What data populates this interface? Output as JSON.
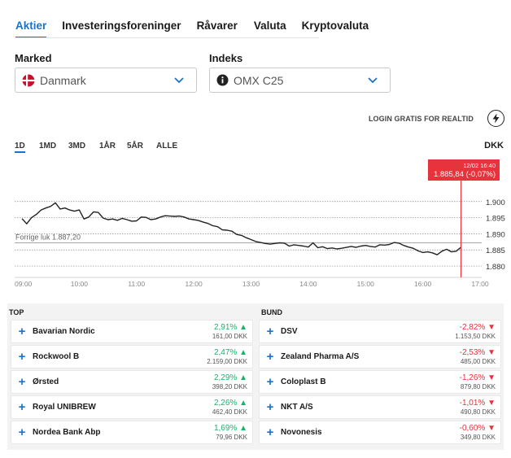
{
  "tabs": [
    {
      "label": "Aktier",
      "active": true
    },
    {
      "label": "Investeringsforeninger",
      "active": false
    },
    {
      "label": "Råvarer",
      "active": false
    },
    {
      "label": "Valuta",
      "active": false
    },
    {
      "label": "Kryptovaluta",
      "active": false
    }
  ],
  "filters": {
    "market_label": "Marked",
    "market_value": "Danmark",
    "index_label": "Indeks",
    "index_value": "OMX C25"
  },
  "login_label": "LOGIN GRATIS FOR REALTID",
  "ranges": [
    {
      "label": "1D",
      "active": true
    },
    {
      "label": "1MD",
      "active": false
    },
    {
      "label": "3MD",
      "active": false
    },
    {
      "label": "1ÅR",
      "active": false
    },
    {
      "label": "5ÅR",
      "active": false
    },
    {
      "label": "ALLE",
      "active": false
    }
  ],
  "currency": "DKK",
  "colors": {
    "accent": "#1a73c9",
    "up": "#1ab36b",
    "down": "#e8323c"
  },
  "chart_data": {
    "type": "line",
    "x_ticks": [
      "09:00",
      "10:00",
      "11:00",
      "12:00",
      "13:00",
      "14:00",
      "15:00",
      "16:00",
      "17:00"
    ],
    "y_ticks": [
      1900,
      1895,
      1890,
      1885,
      1880
    ],
    "y_tick_labels": [
      "1.900",
      "1.895",
      "1.890",
      "1.885",
      "1.880"
    ],
    "ylim": [
      1878.5,
      1907
    ],
    "xlim": [
      "09:00",
      "17:00"
    ],
    "reference_label": "Forrige luk 1.887,20",
    "reference_value": 1887.2,
    "cursor_time": "16:40",
    "tooltip_date": "12/02 16:40",
    "tooltip_value": "1.885,84 (-0,07%)",
    "series": [
      {
        "x": [
          "09:00",
          "09:05",
          "09:10",
          "09:15",
          "09:20",
          "09:25",
          "09:30",
          "09:35",
          "09:40",
          "09:45",
          "09:50",
          "09:55",
          "10:00",
          "10:05",
          "10:10",
          "10:15",
          "10:20",
          "10:25",
          "10:30",
          "10:35",
          "10:40",
          "10:45",
          "10:50",
          "10:55",
          "11:00",
          "11:05",
          "11:10",
          "11:15",
          "11:20",
          "11:25",
          "11:30",
          "11:35",
          "11:40",
          "11:45",
          "11:50",
          "11:55",
          "12:00",
          "12:05",
          "12:10",
          "12:15",
          "12:20",
          "12:25",
          "12:30",
          "12:35",
          "12:40",
          "12:45",
          "12:50",
          "12:55",
          "13:00",
          "13:05",
          "13:10",
          "13:15",
          "13:20",
          "13:25",
          "13:30",
          "13:35",
          "13:40",
          "13:45",
          "13:50",
          "13:55",
          "14:00",
          "14:05",
          "14:10",
          "14:15",
          "14:20",
          "14:25",
          "14:30",
          "14:35",
          "14:40",
          "14:45",
          "14:50",
          "14:55",
          "15:00",
          "15:05",
          "15:10",
          "15:15",
          "15:20",
          "15:25",
          "15:30",
          "15:35",
          "15:40",
          "15:45",
          "15:50",
          "15:55",
          "16:00",
          "16:05",
          "16:10",
          "16:15",
          "16:20",
          "16:25",
          "16:30",
          "16:35",
          "16:40"
        ],
        "values": [
          1894.7,
          1893.1,
          1895.0,
          1896.0,
          1897.4,
          1898.0,
          1898.5,
          1899.6,
          1897.7,
          1898.0,
          1897.4,
          1897.0,
          1897.4,
          1894.6,
          1895.2,
          1896.8,
          1896.6,
          1894.9,
          1894.4,
          1894.6,
          1894.2,
          1894.8,
          1894.4,
          1893.9,
          1894.0,
          1895.2,
          1895.1,
          1894.4,
          1894.6,
          1895.2,
          1895.6,
          1895.5,
          1895.4,
          1895.5,
          1895.2,
          1894.6,
          1894.4,
          1894.1,
          1893.6,
          1893.2,
          1892.5,
          1892.2,
          1891.2,
          1891.1,
          1890.8,
          1889.8,
          1889.5,
          1888.8,
          1888.2,
          1887.6,
          1887.3,
          1887.0,
          1886.8,
          1887.0,
          1887.2,
          1887.1,
          1886.2,
          1886.6,
          1886.4,
          1886.2,
          1885.9,
          1887.2,
          1885.7,
          1886.0,
          1885.4,
          1885.6,
          1885.3,
          1885.5,
          1885.8,
          1886.1,
          1885.8,
          1886.2,
          1886.4,
          1886.1,
          1885.9,
          1886.6,
          1886.5,
          1886.7,
          1887.3,
          1887.1,
          1886.4,
          1885.9,
          1885.5,
          1884.7,
          1884.2,
          1884.4,
          1884.1,
          1883.5,
          1884.6,
          1885.2,
          1884.4,
          1884.6,
          1885.84
        ]
      }
    ]
  },
  "top": {
    "title": "TOP",
    "items": [
      {
        "name": "Bavarian Nordic",
        "pct": "2,91%",
        "price": "161,00 DKK"
      },
      {
        "name": "Rockwool B",
        "pct": "2,47%",
        "price": "2.159,00 DKK"
      },
      {
        "name": "Ørsted",
        "pct": "2,29%",
        "price": "398,20 DKK"
      },
      {
        "name": "Royal UNIBREW",
        "pct": "2,26%",
        "price": "462,40 DKK"
      },
      {
        "name": "Nordea Bank Abp",
        "pct": "1,69%",
        "price": "79,96 DKK"
      }
    ]
  },
  "bottom": {
    "title": "BUND",
    "items": [
      {
        "name": "DSV",
        "pct": "-2,82%",
        "price": "1.153,50 DKK"
      },
      {
        "name": "Zealand Pharma A/S",
        "pct": "-2,53%",
        "price": "485,00 DKK"
      },
      {
        "name": "Coloplast B",
        "pct": "-1,26%",
        "price": "879,80 DKK"
      },
      {
        "name": "NKT A/S",
        "pct": "-1,01%",
        "price": "490,80 DKK"
      },
      {
        "name": "Novonesis",
        "pct": "-0,60%",
        "price": "349,80 DKK"
      }
    ]
  }
}
